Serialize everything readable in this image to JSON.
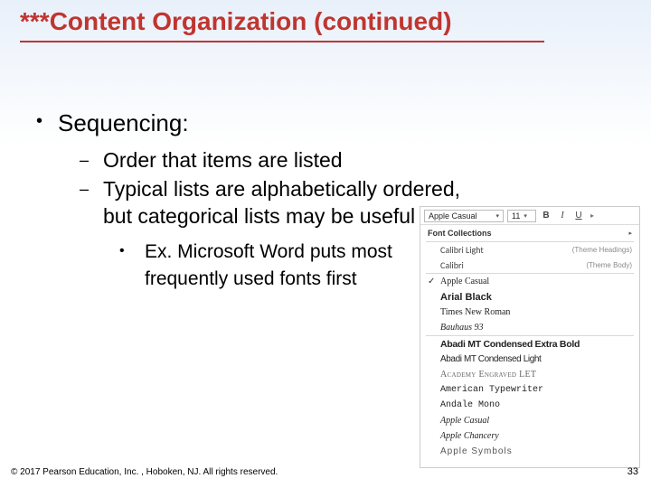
{
  "title": "***Content Organization (continued)",
  "bullets": {
    "lvl1": "Sequencing:",
    "lvl2a": "Order that items are listed",
    "lvl2b": "Typical lists are alphabetically ordered, but categorical lists may be useful",
    "lvl3": "Ex. Microsoft Word puts most frequently used fonts first"
  },
  "footer": "© 2017 Pearson Education, Inc. , Hoboken, NJ.  All rights reserved.",
  "page": "33",
  "fontmenu": {
    "toolbar": {
      "fontname": "Apple Casual",
      "size": "11",
      "bold": "B",
      "italic": "I",
      "underline": "U"
    },
    "section_collections": "Font Collections",
    "items": {
      "calibri_light": "Calibri Light",
      "calibri_light_hint": "(Theme Headings)",
      "calibri": "Calibri",
      "calibri_hint": "(Theme Body)",
      "apple_casual": "Apple Casual",
      "arial_black": "Arial Black",
      "times": "Times New Roman",
      "bauhaus": "Bauhaus 93",
      "abadi_xbold": "Abadi MT Condensed Extra Bold",
      "abadi_light": "Abadi MT Condensed Light",
      "engraved": "Academy Engraved LET",
      "typewriter": "American Typewriter",
      "andale": "Andale Mono",
      "apple_casual2": "Apple Casual",
      "chancery": "Apple Chancery",
      "symbols": "Apple Symbols"
    }
  }
}
